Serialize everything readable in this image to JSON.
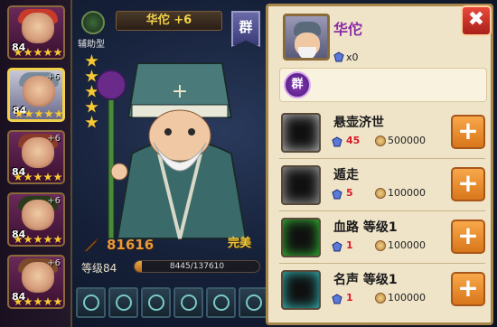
{
  "roster": [
    {
      "level": "84",
      "plus": "",
      "hair": "#c83a2a",
      "stars": 5,
      "selected": false
    },
    {
      "level": "84",
      "plus": "+6",
      "hair": "#7a8a9a",
      "stars": 5,
      "selected": true
    },
    {
      "level": "84",
      "plus": "+6",
      "hair": "#8a3a2a",
      "stars": 5,
      "selected": false
    },
    {
      "level": "84",
      "plus": "+6",
      "hair": "#2a3a1a",
      "stars": 5,
      "selected": false
    },
    {
      "level": "84",
      "plus": "+6",
      "hair": "#7a4a2a",
      "stars": 5,
      "selected": false
    }
  ],
  "hero": {
    "title": "华佗 +6",
    "type_label": "辅助型",
    "faction_glyph": "群",
    "power": "81616",
    "quality": "完美",
    "level_label": "等级84",
    "exp_text": "8445/137610",
    "exp_fraction": 0.061,
    "stars": 5
  },
  "equipment": [
    "equip-1",
    "equip-2",
    "equip-3",
    "equip-4",
    "equip-5",
    "equip-6"
  ],
  "panel": {
    "name": "华佗",
    "gem_count": "x0",
    "faction_glyph": "群",
    "close": "✖",
    "skills": [
      {
        "name": "悬壶济世",
        "gem_cost": "45",
        "gem_color": "#d81a2a",
        "coin_cost": "500000",
        "icon_color": "#c8c8c8"
      },
      {
        "name": "遁走",
        "gem_cost": "5",
        "gem_color": "#d81a2a",
        "coin_cost": "100000",
        "icon_color": "#a8a8a8"
      },
      {
        "name": "血路  等级1",
        "gem_cost": "1",
        "gem_color": "#d81a2a",
        "coin_cost": "100000",
        "icon_color": "#3ac83a"
      },
      {
        "name": "名声  等级1",
        "gem_cost": "1",
        "gem_color": "#d81a2a",
        "coin_cost": "100000",
        "icon_color": "#3ac8c8"
      }
    ],
    "plus_label": "+"
  },
  "colors": {
    "accent": "#f2d24a",
    "panel_bg": "#efe4c8",
    "name": "#8a2aa8"
  },
  "icons": {
    "type": "support-type-icon",
    "faction": "faction-qun-icon",
    "power": "sword-power-icon",
    "gem": "gem-icon",
    "coin": "coin-icon",
    "close": "close-icon",
    "plus": "plus-icon"
  }
}
